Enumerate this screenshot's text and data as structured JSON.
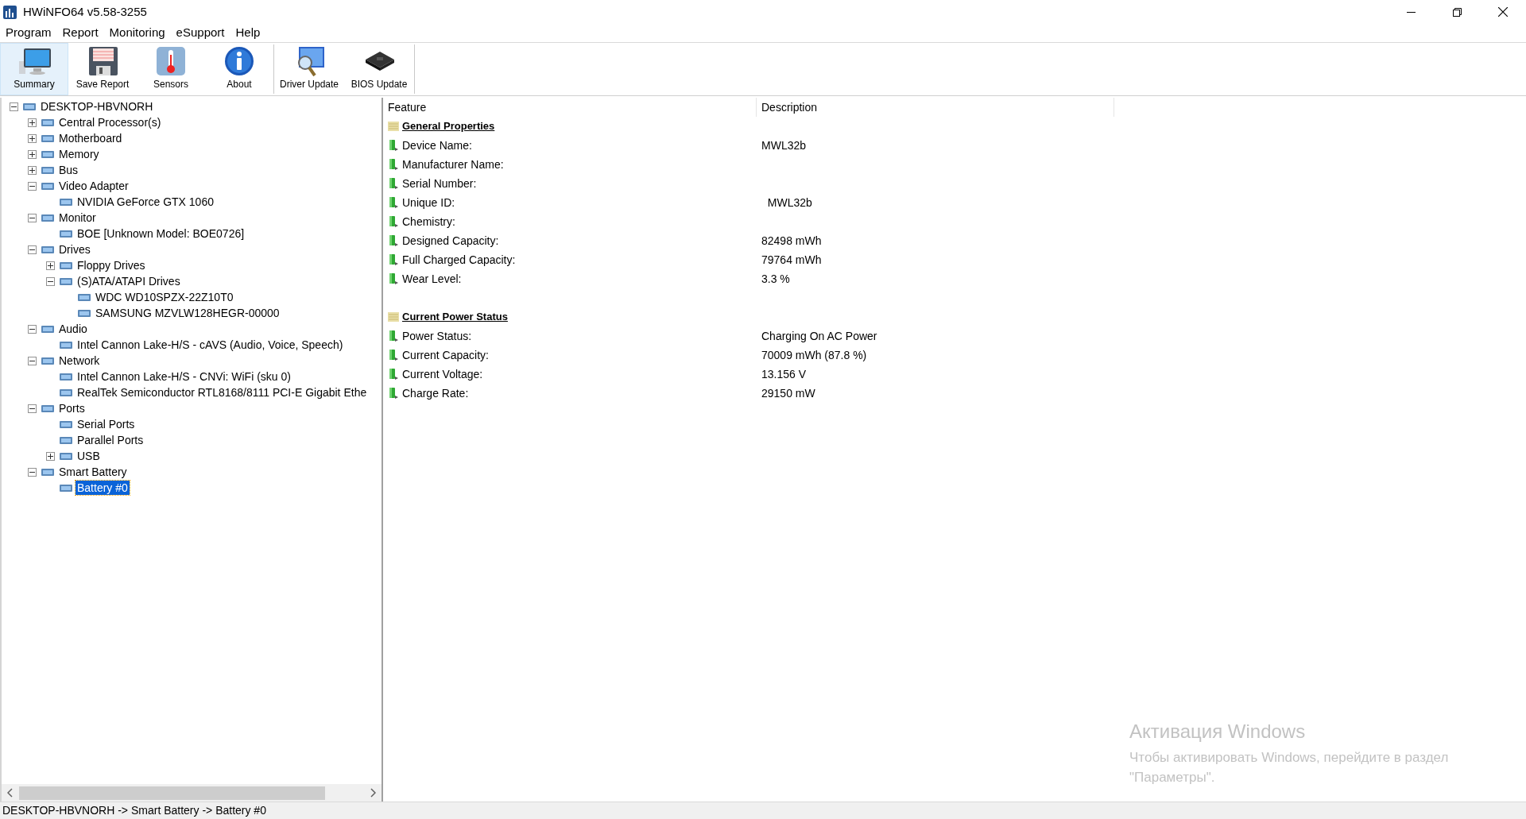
{
  "window": {
    "title": "HWiNFO64 v5.58-3255"
  },
  "menu": [
    "Program",
    "Report",
    "Monitoring",
    "eSupport",
    "Help"
  ],
  "toolbar": [
    {
      "label": "Summary",
      "selected": true
    },
    {
      "label": "Save Report",
      "selected": false
    },
    {
      "label": "Sensors",
      "selected": false
    },
    {
      "label": "About",
      "selected": false
    },
    {
      "label": "Driver Update",
      "selected": false
    },
    {
      "label": "BIOS Update",
      "selected": false
    }
  ],
  "tree": [
    {
      "label": "DESKTOP-HBVNORH",
      "expanded": true,
      "selected": false,
      "children": [
        {
          "label": "Central Processor(s)",
          "expanded": false,
          "selected": false
        },
        {
          "label": "Motherboard",
          "expanded": false,
          "selected": false
        },
        {
          "label": "Memory",
          "expanded": false,
          "selected": false
        },
        {
          "label": "Bus",
          "expanded": false,
          "selected": false
        },
        {
          "label": "Video Adapter",
          "expanded": true,
          "selected": false,
          "children": [
            {
              "label": "NVIDIA GeForce GTX 1060",
              "selected": false
            }
          ]
        },
        {
          "label": "Monitor",
          "expanded": true,
          "selected": false,
          "children": [
            {
              "label": "BOE [Unknown Model: BOE0726]",
              "selected": false
            }
          ]
        },
        {
          "label": "Drives",
          "expanded": true,
          "selected": false,
          "children": [
            {
              "label": "Floppy Drives",
              "expanded": false,
              "selected": false
            },
            {
              "label": "(S)ATA/ATAPI Drives",
              "expanded": true,
              "selected": false,
              "children": [
                {
                  "label": "WDC WD10SPZX-22Z10T0",
                  "selected": false
                },
                {
                  "label": "SAMSUNG MZVLW128HEGR-00000",
                  "selected": false
                }
              ]
            }
          ]
        },
        {
          "label": "Audio",
          "expanded": true,
          "selected": false,
          "children": [
            {
              "label": "Intel Cannon Lake-H/S - cAVS (Audio, Voice, Speech)",
              "selected": false
            }
          ]
        },
        {
          "label": "Network",
          "expanded": true,
          "selected": false,
          "children": [
            {
              "label": "Intel Cannon Lake-H/S - CNVi: WiFi (sku 0)",
              "selected": false
            },
            {
              "label": "RealTek Semiconductor RTL8168/8111 PCI-E Gigabit Ethe",
              "selected": false
            }
          ]
        },
        {
          "label": "Ports",
          "expanded": true,
          "selected": false,
          "children": [
            {
              "label": "Serial Ports",
              "selected": false
            },
            {
              "label": "Parallel Ports",
              "selected": false
            },
            {
              "label": "USB",
              "expanded": false,
              "selected": false
            }
          ]
        },
        {
          "label": "Smart Battery",
          "expanded": true,
          "selected": false,
          "children": [
            {
              "label": "Battery #0",
              "selected": true
            }
          ]
        }
      ]
    }
  ],
  "table": {
    "columns": [
      "Feature",
      "Description"
    ],
    "rows": [
      {
        "kind": "section",
        "feature": "General Properties"
      },
      {
        "kind": "item",
        "feature": "Device Name:",
        "description": "MWL32b"
      },
      {
        "kind": "item",
        "feature": "Manufacturer Name:"
      },
      {
        "kind": "item",
        "feature": "Serial Number:"
      },
      {
        "kind": "item",
        "feature": "Unique ID:",
        "description": "  MWL32b"
      },
      {
        "kind": "item",
        "feature": "Chemistry:"
      },
      {
        "kind": "item",
        "feature": "Designed Capacity:",
        "description": "82498 mWh"
      },
      {
        "kind": "item",
        "feature": "Full Charged Capacity:",
        "description": "79764 mWh"
      },
      {
        "kind": "item",
        "feature": "Wear Level:",
        "description": "3.3 %"
      },
      {
        "kind": "blank"
      },
      {
        "kind": "section",
        "feature": "Current Power Status"
      },
      {
        "kind": "item",
        "feature": "Power Status:",
        "description": "Charging On AC Power"
      },
      {
        "kind": "item",
        "feature": "Current Capacity:",
        "description": "70009 mWh (87.8 %)"
      },
      {
        "kind": "item",
        "feature": "Current Voltage:",
        "description": "13.156 V"
      },
      {
        "kind": "item",
        "feature": "Charge Rate:",
        "description": "29150 mW"
      }
    ]
  },
  "activation_notice": {
    "title": "Активация Windows",
    "text": "Чтобы активировать Windows, перейдите в раздел \"Параметры\"."
  },
  "status_bar": "DESKTOP-HBVNORH -> Smart Battery -> Battery #0"
}
